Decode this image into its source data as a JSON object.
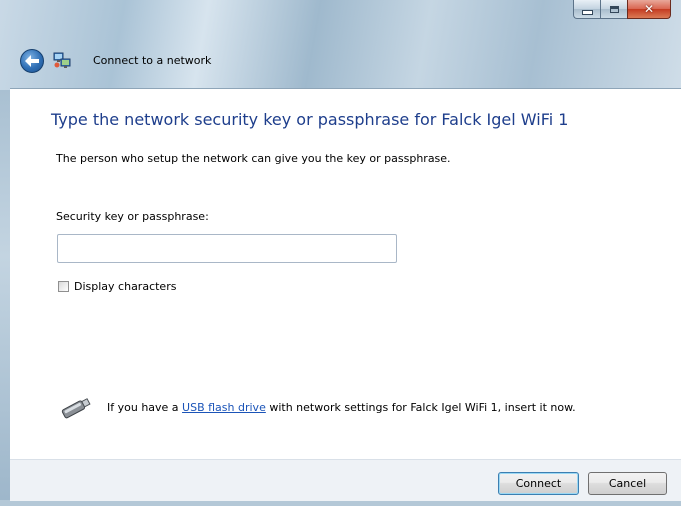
{
  "window": {
    "title": "Connect to a network"
  },
  "main": {
    "heading": "Type the network security key or passphrase for Falck Igel WiFi 1",
    "description": "The person who setup the network can give you the key or passphrase.",
    "key_label": "Security key or passphrase:",
    "key_value": "",
    "display_characters_label": "Display characters",
    "display_characters_checked": false
  },
  "usb": {
    "text_before": "If you have a ",
    "link": "USB flash drive",
    "text_after": " with network settings for Falck Igel WiFi 1, insert it now."
  },
  "buttons": {
    "connect": "Connect",
    "cancel": "Cancel"
  },
  "icons": {
    "back": "back-arrow-icon",
    "network": "network-icon",
    "usb": "usb-drive-icon",
    "minimize": "minimize-icon",
    "maximize": "maximize-icon",
    "close": "close-icon"
  },
  "colors": {
    "heading": "#1e3e8c",
    "link": "#1b54b8",
    "close_button": "#c43b21",
    "footer_background": "#eef2f6"
  }
}
